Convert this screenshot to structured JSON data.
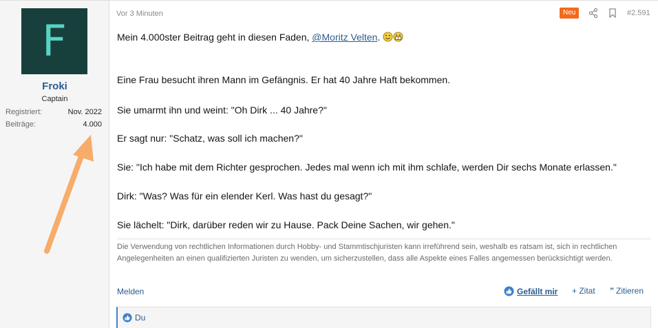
{
  "user": {
    "avatar_letter": "F",
    "name": "Froki",
    "title": "Captain",
    "stats": [
      {
        "label": "Registriert:",
        "value": "Nov. 2022"
      },
      {
        "label": "Beiträge:",
        "value": "4.000"
      }
    ]
  },
  "post": {
    "time": "Vor 3 Minuten",
    "badge": "Neu",
    "number": "#2.591",
    "intro_text": "Mein 4.000ster Beitrag geht in diesen Faden, ",
    "mention": "@Moritz Velten",
    "intro_suffix": ".",
    "paragraphs": [
      "Eine Frau besucht ihren Mann im Gefängnis. Er hat 40 Jahre Haft bekommen.",
      "Sie umarmt ihn und weint: \"Oh Dirk ... 40 Jahre?\"",
      "Er sagt nur: \"Schatz, was soll ich machen?\"",
      "Sie: \"Ich habe mit dem Richter gesprochen. Jedes mal wenn ich mit ihm schlafe, werden Dir sechs Monate erlassen.\"",
      "Dirk: \"Was? Was für ein elender Kerl. Was hast du gesagt?\"",
      "Sie lächelt: \"Dirk, darüber reden wir zu Hause. Pack Deine Sachen, wir gehen.\""
    ],
    "signature": "Die Verwendung von rechtlichen Informationen durch Hobby- und Stammtischjuristen kann irreführend sein, weshalb es ratsam ist, sich in rechtlichen Angelegenheiten an einen qualifizierten Juristen zu wenden, um sicherzustellen, dass alle Aspekte eines Falles angemessen berücksichtigt werden."
  },
  "actions": {
    "report": "Melden",
    "like": "Gefällt mir",
    "quote_plus": "+ Zitat",
    "quote": "Zitieren"
  },
  "reactions": {
    "text": "Du"
  },
  "colors": {
    "accent": "#2b5c8f",
    "avatar_bg": "#17403d",
    "avatar_fg": "#57d3c4",
    "badge": "#f26a1b",
    "arrow": "#f7ac6a"
  },
  "icons": [
    "share-icon",
    "bookmark-icon",
    "like-icon",
    "quote-icon",
    "smile-icon",
    "grin-icon",
    "arrow-annotation"
  ]
}
